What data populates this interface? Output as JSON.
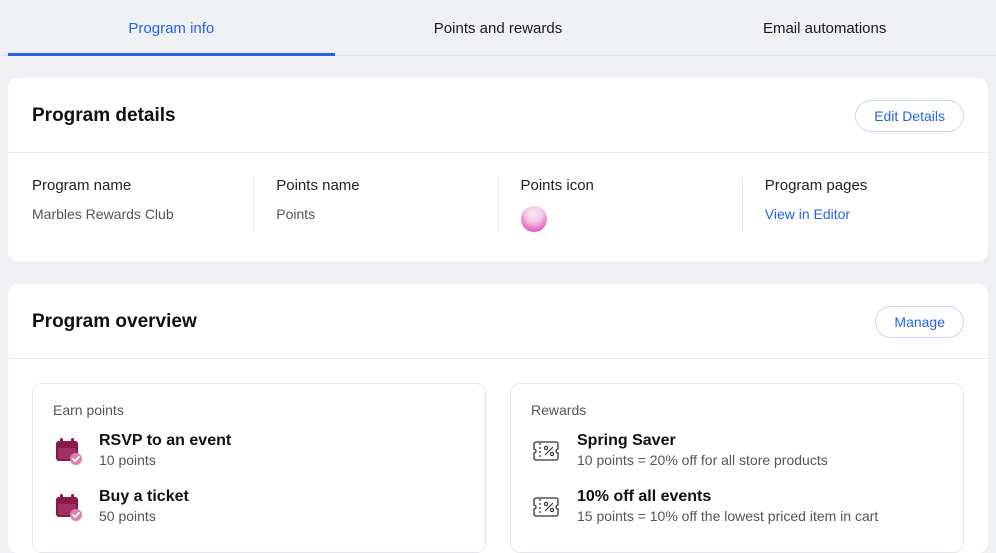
{
  "tabs": {
    "program_info": "Program info",
    "points_and_rewards": "Points and rewards",
    "email_automations": "Email automations"
  },
  "program_details": {
    "title": "Program details",
    "edit_button": "Edit Details",
    "columns": {
      "program_name": {
        "label": "Program name",
        "value": "Marbles Rewards Club"
      },
      "points_name": {
        "label": "Points name",
        "value": "Points"
      },
      "points_icon": {
        "label": "Points icon"
      },
      "program_pages": {
        "label": "Program pages",
        "link": "View in Editor"
      }
    }
  },
  "program_overview": {
    "title": "Program overview",
    "manage_button": "Manage",
    "earn_points": {
      "label": "Earn points",
      "items": [
        {
          "title": "RSVP to an event",
          "sub": "10 points"
        },
        {
          "title": "Buy a ticket",
          "sub": "50 points"
        }
      ]
    },
    "rewards": {
      "label": "Rewards",
      "items": [
        {
          "title": "Spring Saver",
          "sub": "10 points = 20% off for all store products"
        },
        {
          "title": "10% off all events",
          "sub": "15 points = 10% off the lowest priced item in cart"
        }
      ]
    }
  }
}
